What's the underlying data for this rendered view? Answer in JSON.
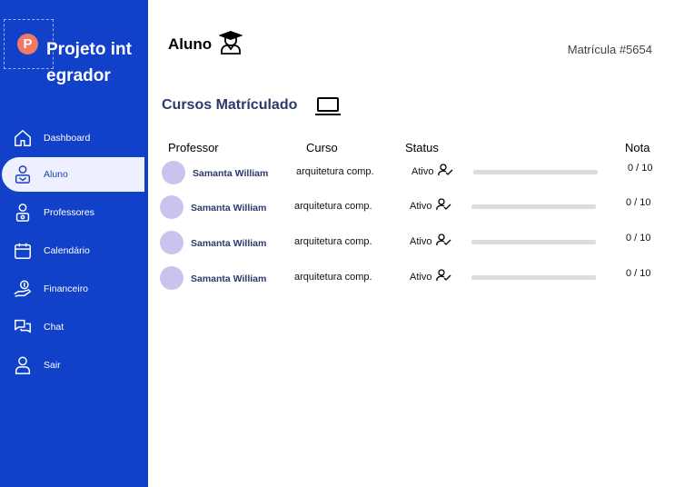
{
  "app": {
    "logo_letter": "P",
    "logo_title": "Projeto integrador"
  },
  "sidebar": {
    "items": [
      {
        "label": "Dashboard",
        "icon": "home-icon",
        "active": false
      },
      {
        "label": "Aluno",
        "icon": "student-icon",
        "active": true
      },
      {
        "label": "Professores",
        "icon": "teacher-icon",
        "active": false
      },
      {
        "label": "Calendário",
        "icon": "calendar-icon",
        "active": false
      },
      {
        "label": "Financeiro",
        "icon": "finance-icon",
        "active": false
      },
      {
        "label": "Chat",
        "icon": "chat-icon",
        "active": false
      },
      {
        "label": "Sair",
        "icon": "logout-user-icon",
        "active": false
      }
    ]
  },
  "header": {
    "title": "Aluno",
    "title_icon": "graduate-icon",
    "registration": "Matrícula #5654"
  },
  "section": {
    "title": "Cursos Matrículado",
    "icon": "laptop-icon"
  },
  "table": {
    "columns": {
      "professor": "Professor",
      "course": "Curso",
      "status": "Status",
      "grade": "Nota"
    },
    "rows": [
      {
        "professor": "Samanta William",
        "course": "arquitetura comp.",
        "status": "Ativo",
        "progress": 0,
        "grade": "0 / 10"
      },
      {
        "professor": "Samanta William",
        "course": "arquitetura comp.",
        "status": "Ativo",
        "progress": 0,
        "grade": "0 / 10"
      },
      {
        "professor": "Samanta William",
        "course": "arquitetura comp.",
        "status": "Ativo",
        "progress": 0,
        "grade": "0 / 10"
      },
      {
        "professor": "Samanta William",
        "course": "arquitetura comp.",
        "status": "Ativo",
        "progress": 0,
        "grade": "0 / 10"
      }
    ]
  },
  "colors": {
    "sidebar": "#1241c9",
    "accent_text": "#2b3a6b",
    "logo_badge": "#f07a63",
    "avatar": "#c9c3ee",
    "progress_track": "#dcdcdc"
  }
}
